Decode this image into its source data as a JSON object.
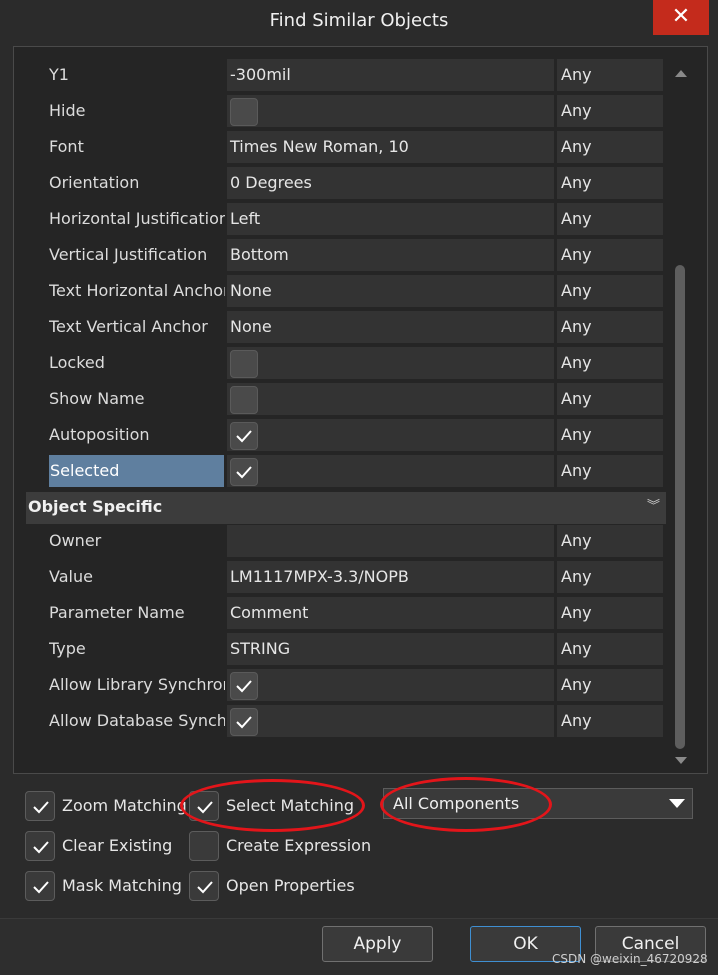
{
  "window": {
    "title": "Find Similar Objects",
    "close_label": "✕"
  },
  "rows_top": [
    {
      "label": "Y1",
      "value": "-300mil",
      "kind": "text",
      "match": "Any"
    },
    {
      "label": "Hide",
      "value": "",
      "kind": "checkbox",
      "checked": false,
      "match": "Any"
    },
    {
      "label": "Font",
      "value": "Times New Roman, 10",
      "kind": "text",
      "match": "Any"
    },
    {
      "label": "Orientation",
      "value": "0 Degrees",
      "kind": "text",
      "match": "Any"
    },
    {
      "label": "Horizontal Justification",
      "value": "Left",
      "kind": "text",
      "match": "Any"
    },
    {
      "label": "Vertical Justification",
      "value": "Bottom",
      "kind": "text",
      "match": "Any"
    },
    {
      "label": "Text Horizontal Anchor",
      "value": "None",
      "kind": "text",
      "match": "Any"
    },
    {
      "label": "Text Vertical Anchor",
      "value": "None",
      "kind": "text",
      "match": "Any"
    },
    {
      "label": "Locked",
      "value": "",
      "kind": "checkbox",
      "checked": false,
      "match": "Any"
    },
    {
      "label": "Show Name",
      "value": "",
      "kind": "checkbox",
      "checked": false,
      "match": "Any"
    },
    {
      "label": "Autoposition",
      "value": "",
      "kind": "checkbox",
      "checked": true,
      "match": "Any"
    },
    {
      "label": "Selected",
      "value": "",
      "kind": "checkbox",
      "checked": true,
      "match": "Any",
      "highlight": true
    }
  ],
  "section": {
    "title": "Object Specific",
    "chevron": "»"
  },
  "rows_object": [
    {
      "label": "Owner",
      "value": "",
      "kind": "text",
      "match": "Any"
    },
    {
      "label": "Value",
      "value": "LM1117MPX-3.3/NOPB",
      "kind": "text",
      "match": "Any"
    },
    {
      "label": "Parameter Name",
      "value": "Comment",
      "kind": "text",
      "match": "Any"
    },
    {
      "label": "Type",
      "value": "STRING",
      "kind": "text",
      "match": "Any"
    },
    {
      "label": "Allow Library Synchronization",
      "value": "",
      "kind": "checkbox",
      "checked": true,
      "match": "Any"
    },
    {
      "label": "Allow Database Synchronization",
      "value": "",
      "kind": "checkbox",
      "checked": true,
      "match": "Any"
    }
  ],
  "options": {
    "zoom_matching": {
      "label": "Zoom Matching",
      "checked": true
    },
    "select_matching": {
      "label": "Select Matching",
      "checked": true
    },
    "clear_existing": {
      "label": "Clear Existing",
      "checked": true
    },
    "create_expression": {
      "label": "Create Expression",
      "checked": false
    },
    "mask_matching": {
      "label": "Mask Matching",
      "checked": true
    },
    "open_properties": {
      "label": "Open Properties",
      "checked": true
    }
  },
  "scope_dropdown": {
    "value": "All Components"
  },
  "buttons": {
    "apply": "Apply",
    "ok": "OK",
    "cancel": "Cancel"
  },
  "watermark": "CSDN @weixin_46720928",
  "colors": {
    "annotation": "#e3151a",
    "selection": "#5f7f9f",
    "close": "#c42b1c"
  }
}
